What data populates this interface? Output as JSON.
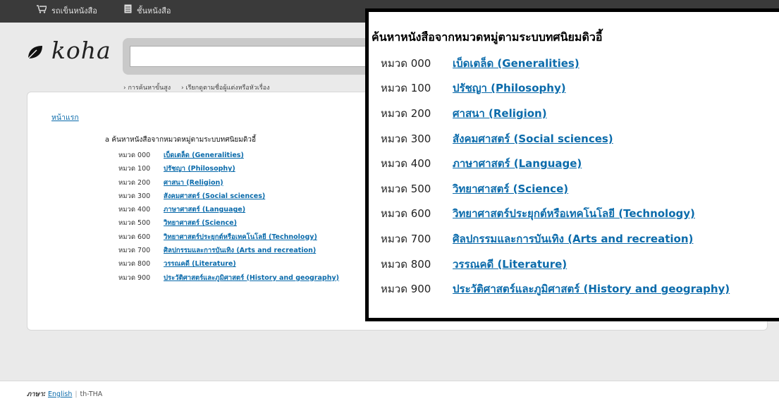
{
  "topbar": {
    "cart_label": "รถเข็นหนังสือ",
    "cart_icon": "cart-icon",
    "shelf_label": "ชั้นหนังสือ",
    "shelf_icon": "list-icon"
  },
  "logo": {
    "text": "koha"
  },
  "search": {
    "value": ""
  },
  "sublinks": {
    "advanced": "› การค้นหาขั้นสูง",
    "browse": "› เรียกดูตามชื่อผู้แต่งหรือหัวเรื่อง"
  },
  "main": {
    "home_link": "หน้าแรก",
    "heading": "ค้นหาหนังสือจากหมวดหมู่ตามระบบทศนิยมดิวอี้",
    "heading_prefix": "a",
    "categories": [
      {
        "code": "หมวด 000",
        "label": "เบ็ดเตล็ด (Generalities)"
      },
      {
        "code": "หมวด 100",
        "label": "ปรัชญา (Philosophy)"
      },
      {
        "code": "หมวด 200",
        "label": "ศาสนา (Religion)"
      },
      {
        "code": "หมวด 300",
        "label": "สังคมศาสตร์ (Social sciences)"
      },
      {
        "code": "หมวด 400",
        "label": "ภาษาศาสตร์ (Language)"
      },
      {
        "code": "หมวด 500",
        "label": "วิทยาศาสตร์ (Science)"
      },
      {
        "code": "หมวด 600",
        "label": "วิทยาศาสตร์ประยุกต์หรือเทคโนโลยี (Technology)"
      },
      {
        "code": "หมวด 700",
        "label": "ศิลปกรรมและการบันเทิง (Arts and recreation)"
      },
      {
        "code": "หมวด 800",
        "label": "วรรณคดี (Literature)"
      },
      {
        "code": "หมวด 900",
        "label": "ประวัติศาสตร์และภูมิศาสตร์ (History and geography)"
      }
    ]
  },
  "footer": {
    "language_label": "ภาษา:",
    "english": "English",
    "current": "th-THA"
  },
  "colors": {
    "link": "#0b6bab",
    "topbar": "#3a3a3a"
  }
}
